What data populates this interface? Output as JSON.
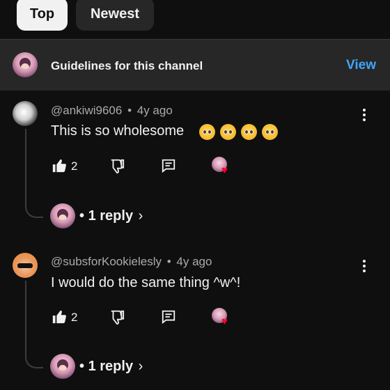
{
  "filter_chips": [
    {
      "label": "Top",
      "active": true
    },
    {
      "label": "Newest",
      "active": false
    }
  ],
  "guidelines": {
    "label": "Guidelines for this channel",
    "action": "View"
  },
  "comments": [
    {
      "handle": "@ankiwi9606",
      "age": "4y ago",
      "text": "This is so wholesome",
      "emoji_count": 4,
      "likes": "2",
      "replies": "1 reply",
      "avatar": "monochrome-avatar"
    },
    {
      "handle": "@subsforKookielesly",
      "age": "4y ago",
      "text": "I would do the same thing ^w^!",
      "likes": "2",
      "replies": "1 reply",
      "avatar": "sunglasses-avatar"
    }
  ],
  "separator": "•",
  "colors": {
    "background": "#0f0f0f",
    "surface": "#272727",
    "link": "#3ea6ff",
    "heart": "#ff0033",
    "muted_text": "#aaaaaa"
  },
  "icons": [
    "thumbs-up-icon",
    "thumbs-down-icon",
    "reply-icon",
    "creator-heart-icon",
    "more-vert-icon",
    "chevron-right-icon"
  ]
}
